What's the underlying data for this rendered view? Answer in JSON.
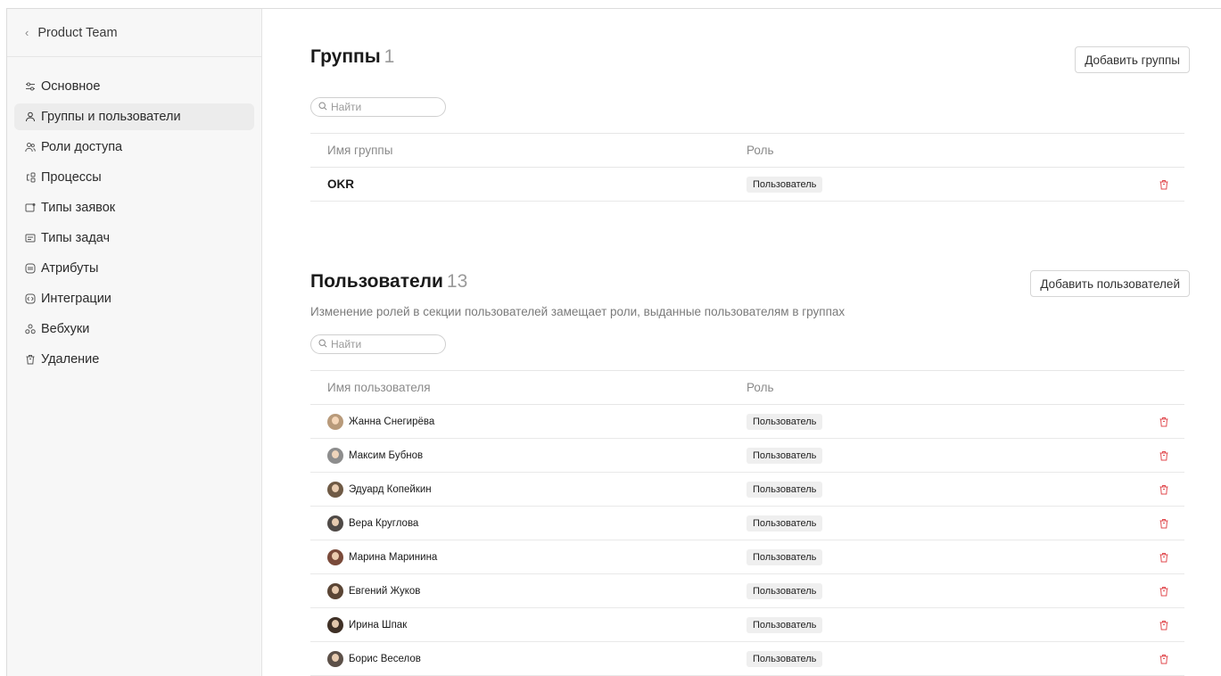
{
  "sidebar": {
    "back_label": "Product Team",
    "items": [
      {
        "label": "Основное",
        "icon": "sliders-icon"
      },
      {
        "label": "Группы и пользователи",
        "icon": "user-icon",
        "active": true
      },
      {
        "label": "Роли доступа",
        "icon": "users-icon"
      },
      {
        "label": "Процессы",
        "icon": "process-icon"
      },
      {
        "label": "Типы заявок",
        "icon": "request-type-icon"
      },
      {
        "label": "Типы задач",
        "icon": "task-type-icon"
      },
      {
        "label": "Атрибуты",
        "icon": "attributes-icon"
      },
      {
        "label": "Интеграции",
        "icon": "integrations-icon"
      },
      {
        "label": "Вебхуки",
        "icon": "webhook-icon"
      },
      {
        "label": "Удаление",
        "icon": "trash-icon"
      }
    ]
  },
  "groups": {
    "title": "Группы",
    "count": "1",
    "add_button": "Добавить группы",
    "search_placeholder": "Найти",
    "columns": {
      "name": "Имя группы",
      "role": "Роль"
    },
    "rows": [
      {
        "name": "OKR",
        "role": "Пользователь"
      }
    ]
  },
  "users": {
    "title": "Пользователи",
    "count": "13",
    "add_button": "Добавить пользователей",
    "subtitle": "Изменение ролей в секции пользователей замещает роли, выданные пользователям в группах",
    "search_placeholder": "Найти",
    "columns": {
      "name": "Имя пользователя",
      "role": "Роль"
    },
    "rows": [
      {
        "name": "Жанна Снегирёва",
        "role": "Пользователь",
        "avatar_color": "#b89a7a"
      },
      {
        "name": "Максим Бубнов",
        "role": "Пользователь",
        "avatar_color": "#8d8d8d"
      },
      {
        "name": "Эдуард Копейкин",
        "role": "Пользователь",
        "avatar_color": "#6f5a45"
      },
      {
        "name": "Вера Круглова",
        "role": "Пользователь",
        "avatar_color": "#4f4a47"
      },
      {
        "name": "Марина Маринина",
        "role": "Пользователь",
        "avatar_color": "#7a4a3a"
      },
      {
        "name": "Евгений Жуков",
        "role": "Пользователь",
        "avatar_color": "#5a4535"
      },
      {
        "name": "Ирина Шпак",
        "role": "Пользователь",
        "avatar_color": "#3f3026"
      },
      {
        "name": "Борис Веселов",
        "role": "Пользователь",
        "avatar_color": "#5c5048"
      }
    ]
  },
  "colors": {
    "delete_icon": "#e0494e",
    "active_item_bg": "#ececec"
  }
}
